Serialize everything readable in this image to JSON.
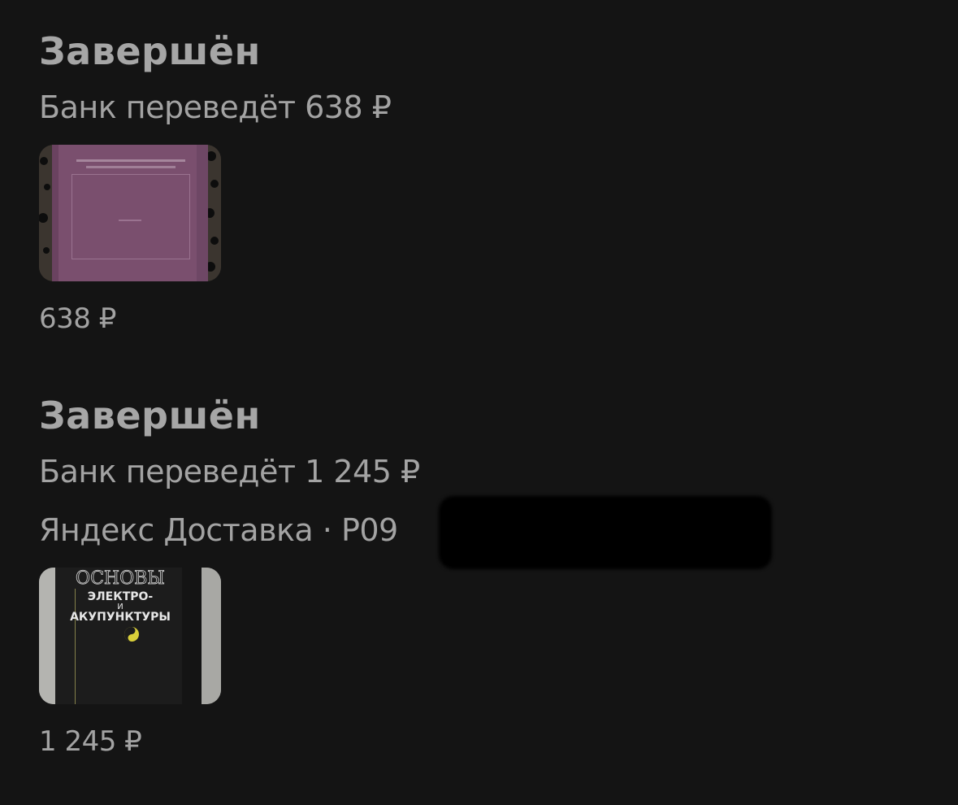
{
  "orders": [
    {
      "status": "Завершён",
      "refund": "Банк переведёт 638 ₽",
      "price": "638 ₽",
      "thumbnail_icon": "book-cover-purple-image"
    },
    {
      "status": "Завершён",
      "refund": "Банк переведёт 1 245 ₽",
      "delivery": "Яндекс Доставка · P09",
      "price": "1 245 ₽",
      "thumbnail_icon": "book-cover-black-image",
      "cover": {
        "line1": "ОСНОВЫ",
        "line2": "ЭЛЕКТРО-",
        "line3": "И",
        "line4": "АКУПУНКТУРЫ"
      }
    }
  ],
  "colors": {
    "background": "#141414",
    "text": "#a3a3a3",
    "cover_purple": "#7a4f6e",
    "cover_black": "#1c1c1c"
  }
}
